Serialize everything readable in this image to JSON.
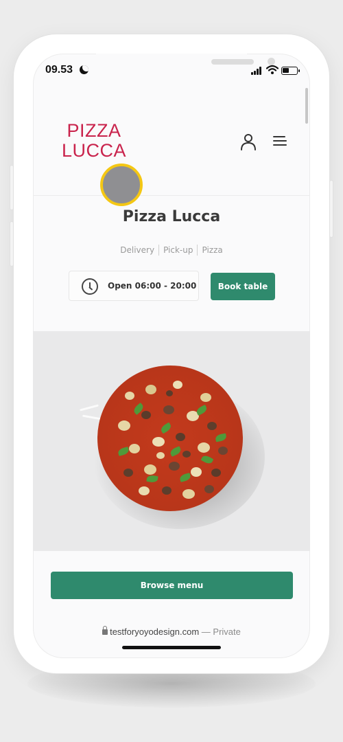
{
  "status_bar": {
    "time": "09.53"
  },
  "header": {
    "logo_line1": "PIZZA",
    "logo_line2": "LUCCA",
    "account_icon": "user-icon",
    "menu_icon": "hamburger-icon"
  },
  "restaurant": {
    "name": "Pizza Lucca",
    "tags": [
      "Delivery",
      "Pick-up",
      "Pizza"
    ],
    "hours": "Open 06:00 - 20:00",
    "book_label": "Book table"
  },
  "hero": {
    "image": "pizza-photo"
  },
  "cta": {
    "browse_label": "Browse menu"
  },
  "browser": {
    "domain": "testforyoyodesign.com",
    "separator": "—",
    "mode": "Private"
  },
  "colors": {
    "brand_red": "#c9234c",
    "brand_green": "#2f8a6d",
    "touch_indicator": "#f4c714"
  }
}
